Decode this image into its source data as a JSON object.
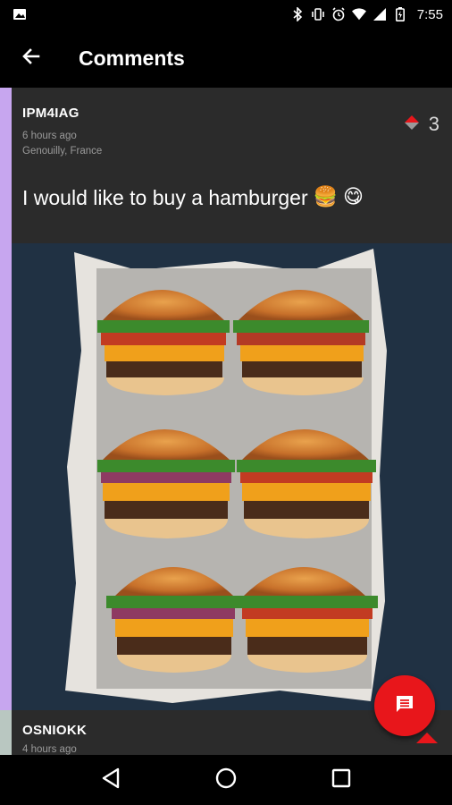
{
  "status_bar": {
    "time": "7:55",
    "icons": [
      "image-icon",
      "bluetooth-icon",
      "vibrate-icon",
      "alarm-icon",
      "wifi-icon",
      "signal-icon",
      "battery-icon"
    ]
  },
  "app_bar": {
    "title": "Comments",
    "back_icon": "arrow-back-icon"
  },
  "comments": [
    {
      "author": "IPM4IAG",
      "time_ago": "6 hours ago",
      "location": "Genouilly, France",
      "votes": "3",
      "text": "I would like to buy a hamburger",
      "emojis": [
        "🍔",
        "😋"
      ],
      "image": "photo of six cheeseburgers in a baking tray"
    },
    {
      "author": "OSNIOKK",
      "time_ago": "4 hours ago"
    }
  ],
  "fab": {
    "icon": "comment-icon"
  },
  "nav_bar": {
    "icons": [
      "nav-back-icon",
      "nav-home-icon",
      "nav-recents-icon"
    ]
  },
  "colors": {
    "accent_strip": "#c7a6ef",
    "card_background": "#2b2b2b",
    "fab": "#e8161b",
    "vote_arrow": "#e8161b"
  }
}
